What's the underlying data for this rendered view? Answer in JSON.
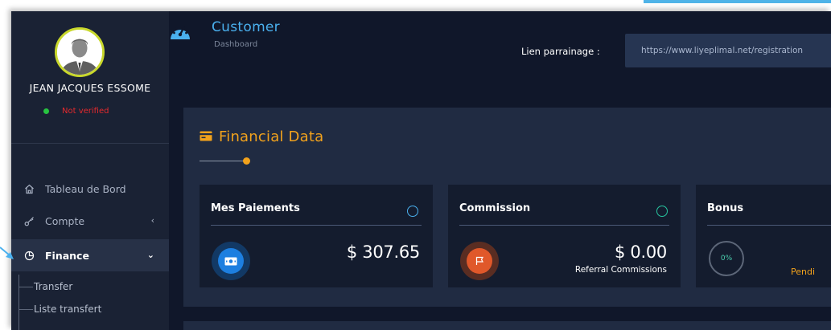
{
  "colors": {
    "accent_blue": "#4ab0ee",
    "accent_orange": "#f2a21c",
    "status_green": "#27c440",
    "status_red": "#e5292d",
    "sidebar_bg": "#1a2234",
    "panel_bg": "#202b42",
    "card_bg": "#141c2e"
  },
  "sidebar": {
    "user_name": "JEAN JACQUES ESSOME",
    "status": "Not verified",
    "items": [
      {
        "label": "Tableau de Bord",
        "icon": "home-icon"
      },
      {
        "label": "Compte",
        "icon": "key-icon"
      },
      {
        "label": "Finance",
        "icon": "pie-chart-icon"
      }
    ],
    "sub_items": [
      {
        "label": "Transfer"
      },
      {
        "label": "Liste transfert"
      }
    ]
  },
  "header": {
    "title": "Customer",
    "subtitle": "Dashboard",
    "referral_label": "Lien parrainage :",
    "referral_value": "https://www.liyeplimal.net/registration"
  },
  "financial": {
    "title": "Financial Data",
    "cards": [
      {
        "title": "Mes Paiements",
        "amount": "$ 307.65",
        "icon": "money-icon"
      },
      {
        "title": "Commission",
        "amount": "$ 0.00",
        "subtitle": "Referral Commissions",
        "icon": "flag-icon"
      },
      {
        "title": "Bonus",
        "percent": "0%",
        "status": "Pendi"
      }
    ]
  }
}
